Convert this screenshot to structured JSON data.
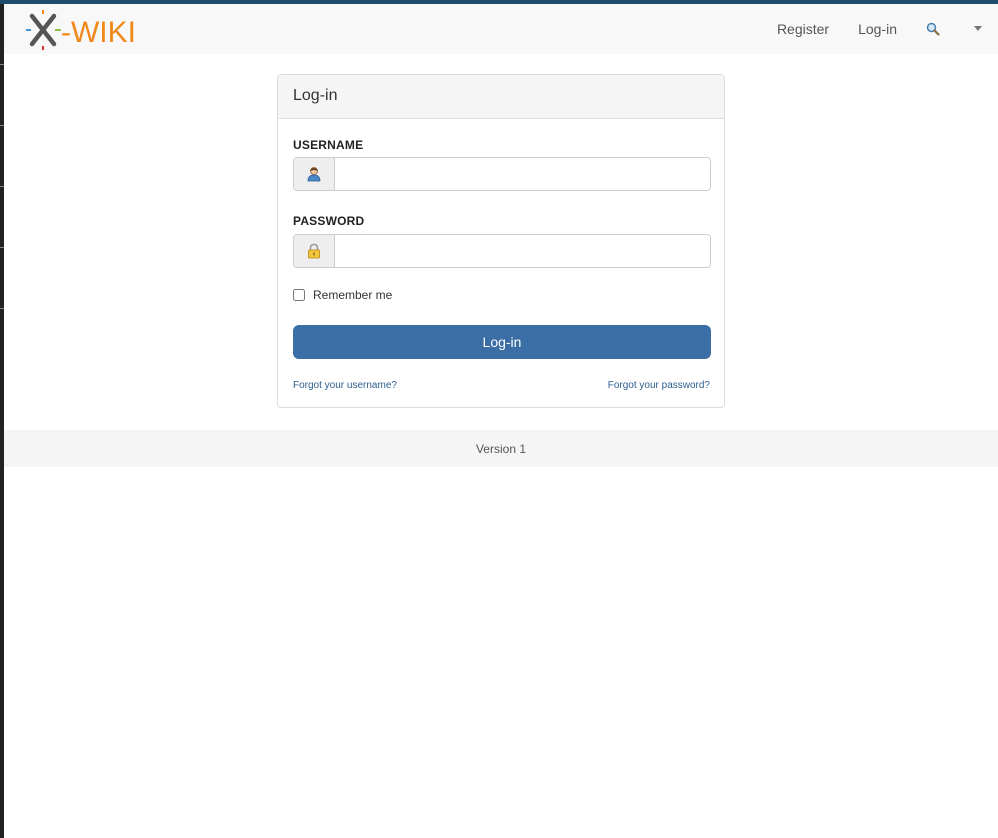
{
  "brand": {
    "logo_text": "X-WIKI"
  },
  "nav": {
    "register_label": "Register",
    "login_label": "Log-in",
    "search_icon": "search-icon",
    "menu_icon": "caret-down-icon"
  },
  "login_form": {
    "title": "Log-in",
    "username_label": "USERNAME",
    "username_value": "",
    "password_label": "PASSWORD",
    "password_value": "",
    "remember_label": "Remember me",
    "remember_checked": false,
    "submit_label": "Log-in",
    "forgot_username": "Forgot your username?",
    "forgot_password": "Forgot your password?"
  },
  "footer": {
    "version_text": "Version 1"
  },
  "colors": {
    "primary": "#3a6ea5",
    "logo_orange": "#f0881a",
    "logo_gray": "#555555",
    "navbar_bg": "#f8f8f8",
    "top_strip": "#1f4e6d"
  }
}
